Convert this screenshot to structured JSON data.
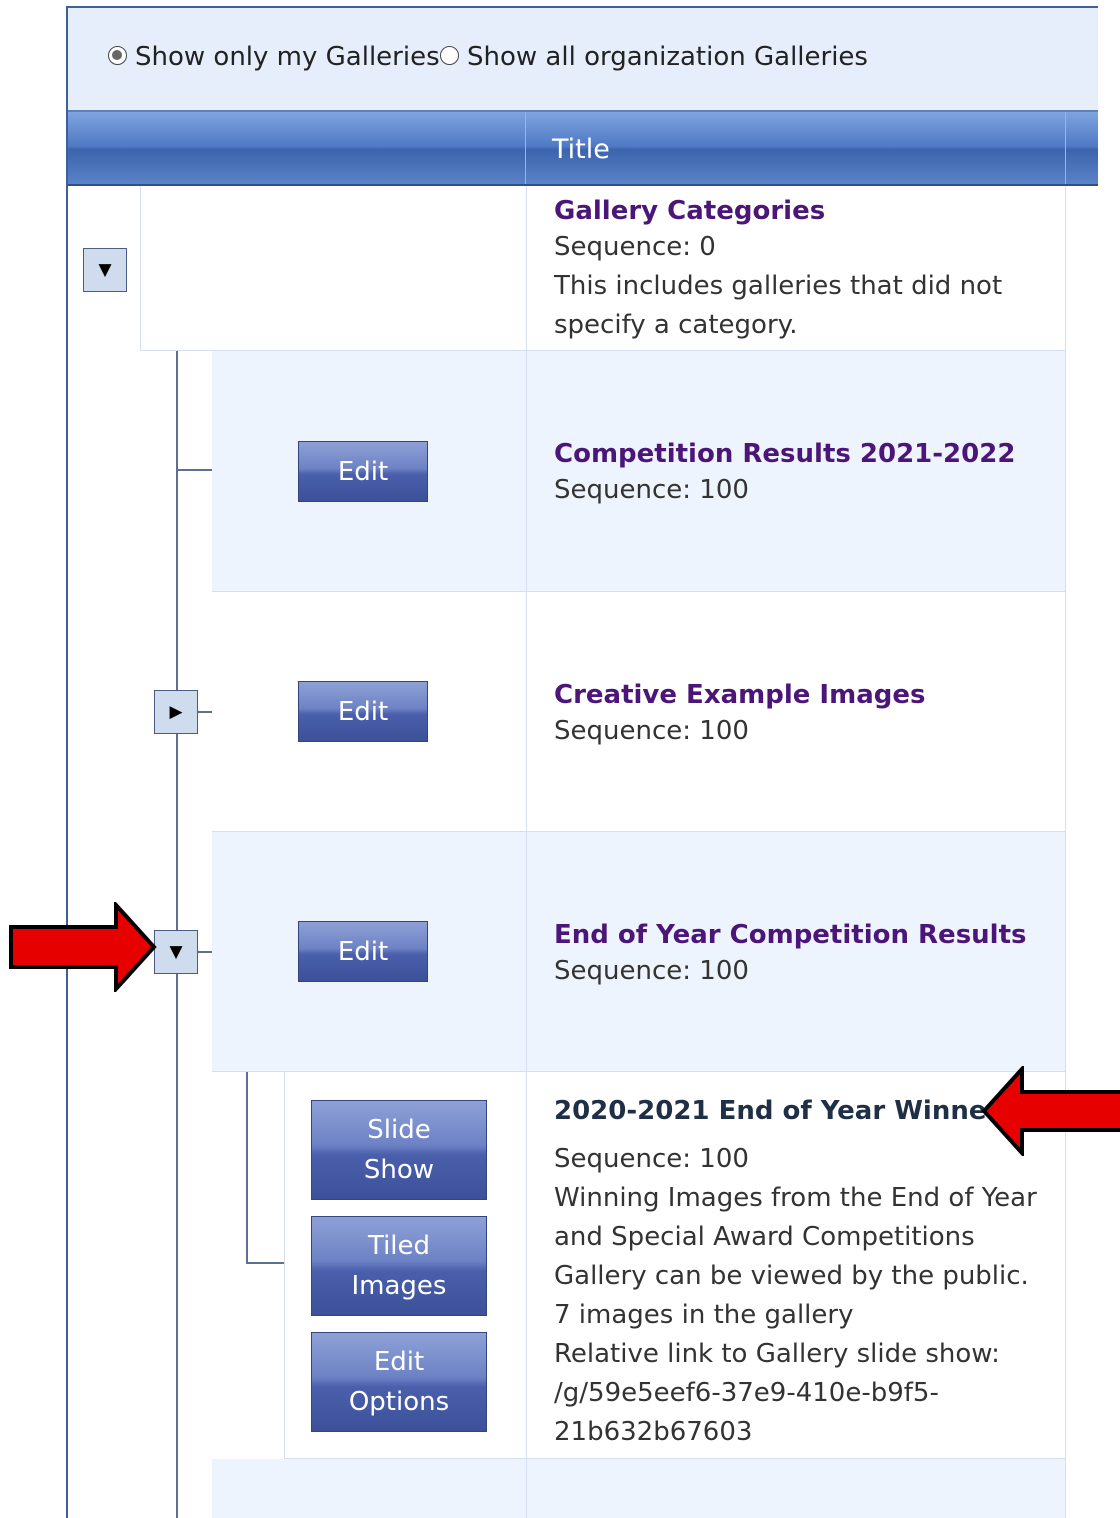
{
  "filter": {
    "option_mine": "Show only my Galleries",
    "option_all": "Show all organization Galleries",
    "selected": "mine"
  },
  "grid": {
    "header_title": "Title"
  },
  "category": {
    "title": "Gallery Categories",
    "sequence": "Sequence: 0",
    "description_line1": "This includes galleries that did not",
    "description_line2": "specify a category."
  },
  "rows": [
    {
      "title": "Competition Results 2021-2022",
      "sequence": "Sequence: 100",
      "edit_label": "Edit"
    },
    {
      "title": "Creative Example Images",
      "sequence": "Sequence: 100",
      "edit_label": "Edit"
    },
    {
      "title": "End of Year Competition Results",
      "sequence": "Sequence: 100",
      "edit_label": "Edit"
    }
  ],
  "gallery": {
    "title": "2020-2021 End of Year Winners",
    "sequence": "Sequence: 100",
    "desc_line1": "Winning Images from the End of Year",
    "desc_line2": "and Special Award Competitions",
    "visibility": "Gallery can be viewed by the public.",
    "image_count": "7 images in the gallery",
    "link_label": "Relative link to Gallery slide show:",
    "link_line1": "/g/59e5eef6-37e9-410e-b9f5-",
    "link_line2": "21b632b67603",
    "slide_show_line1": "Slide",
    "slide_show_line2": "Show",
    "tiled_line1": "Tiled",
    "tiled_line2": "Images",
    "options_line1": "Edit",
    "options_line2": "Options"
  },
  "colors": {
    "link_purple": "#4b1677",
    "header_blue": "#4f79c4",
    "alt_row": "#eef4fd",
    "arrow_red": "#e60000"
  },
  "icons": {
    "collapse": "triangle-down",
    "expand": "triangle-right",
    "annotation": "red-arrow"
  }
}
